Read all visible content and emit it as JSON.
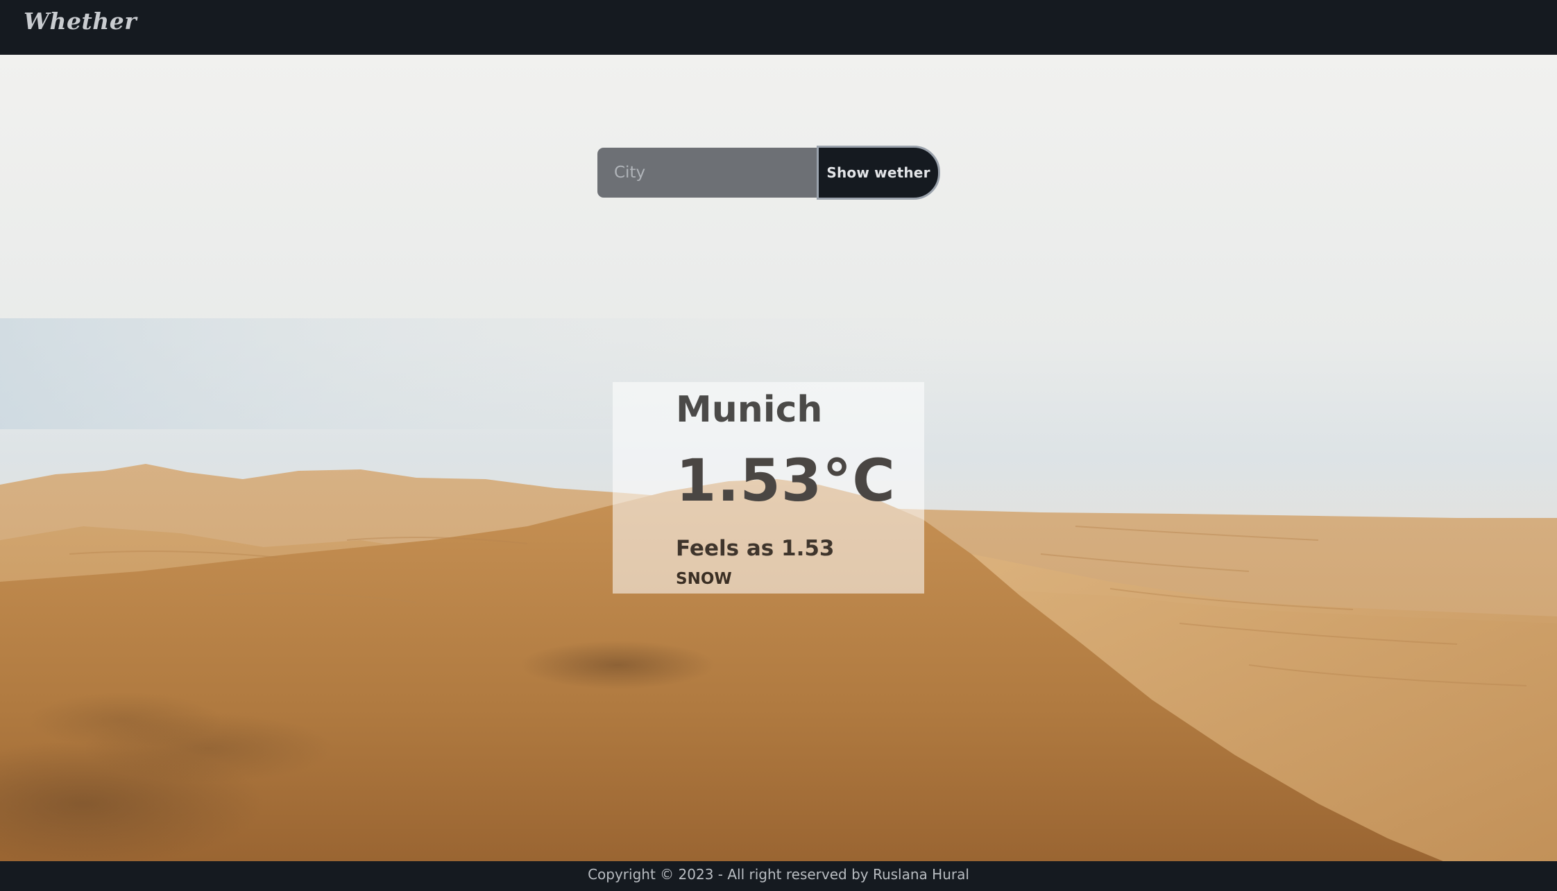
{
  "navbar": {
    "brand": "Whether"
  },
  "search": {
    "placeholder": "City",
    "value": "",
    "button_label": "Show wether"
  },
  "weather": {
    "city": "Munich",
    "temperature": "1.53°C",
    "feels_like": "Feels as 1.53",
    "condition": "SNOW"
  },
  "footer": {
    "copyright": "Copyright © 2023 - All right reserved by Ruslana Hural"
  },
  "colors": {
    "navbar_bg": "#151a20",
    "input_bg": "#6d7075",
    "button_bg": "#151a20",
    "card_bg": "rgba(255,255,255,0.55)",
    "sand": "#c89458",
    "sky": "#ececea"
  },
  "background": {
    "icon": "desert-dunes-image"
  }
}
